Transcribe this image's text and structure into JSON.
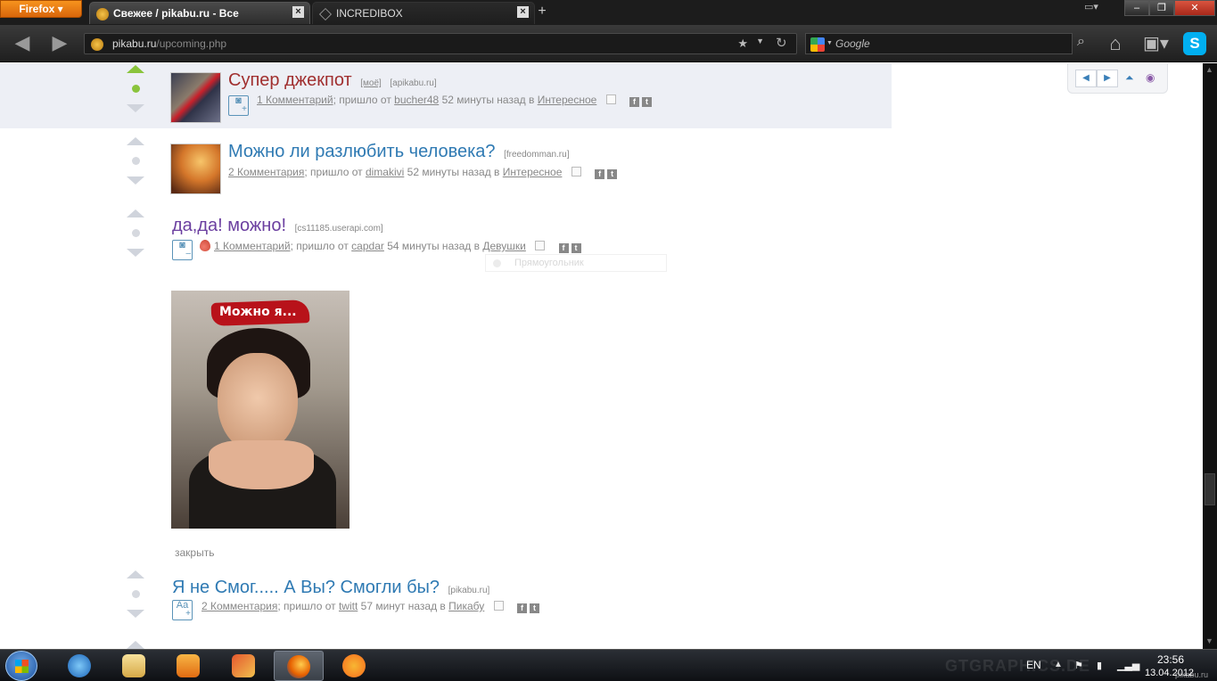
{
  "browser": {
    "menu_button": "Firefox",
    "tabs": [
      {
        "title": "Свежее / pikabu.ru - Все",
        "active": true
      },
      {
        "title": "INCREDIBOX",
        "active": false
      }
    ],
    "url_host": "pikabu.ru",
    "url_path": "/upcoming.php",
    "search_engine": "Google",
    "search_placeholder": "Google"
  },
  "stories": [
    {
      "title": "Супер джекпот",
      "mine_label": "[моё]",
      "source": "[apikabu.ru]",
      "title_color": "#a02f2f",
      "comments": "1 Комментарий",
      "text_from": "; пришло от",
      "author": "bucher48",
      "time": "52 минуты назад в",
      "category": "Интересное",
      "voted": true
    },
    {
      "title": "Можно ли разлюбить человека?",
      "source": "[freedomman.ru]",
      "title_color": "#2f7ab3",
      "comments": "2 Комментария",
      "text_from": "; пришло от",
      "author": "dimakivi",
      "time": "52 минуты назад в",
      "category": "Интересное"
    },
    {
      "title": "да,да! можно!",
      "source": "[cs11185.userapi.com]",
      "title_color": "#6b3fa0",
      "comments": "1 Комментарий",
      "text_from": "; пришло от",
      "author": "capdar",
      "time": "54 минуты назад в",
      "category": "Девушки",
      "image_caption": "Можно я..."
    },
    {
      "title": "Я не Смог..... А Вы? Смогли бы?",
      "source": "[pikabu.ru]",
      "title_color": "#2f7ab3",
      "comments": "2 Комментария",
      "text_from": "; пришло от",
      "author": "twitt",
      "time": "57 минут назад в",
      "category": "Пикабу"
    }
  ],
  "close_label": "закрыть",
  "ghost_tooltip": "Прямоугольник",
  "taskbar": {
    "language": "EN",
    "time": "23:56",
    "date": "13.04.2012",
    "watermark": "GTGRAPHICS.DE",
    "corner_text": "pikabu.ru"
  },
  "colors": {
    "highlight_row": "#edeff5",
    "vote_active": "#8ac43c",
    "link_blue": "#2f7ab3"
  }
}
